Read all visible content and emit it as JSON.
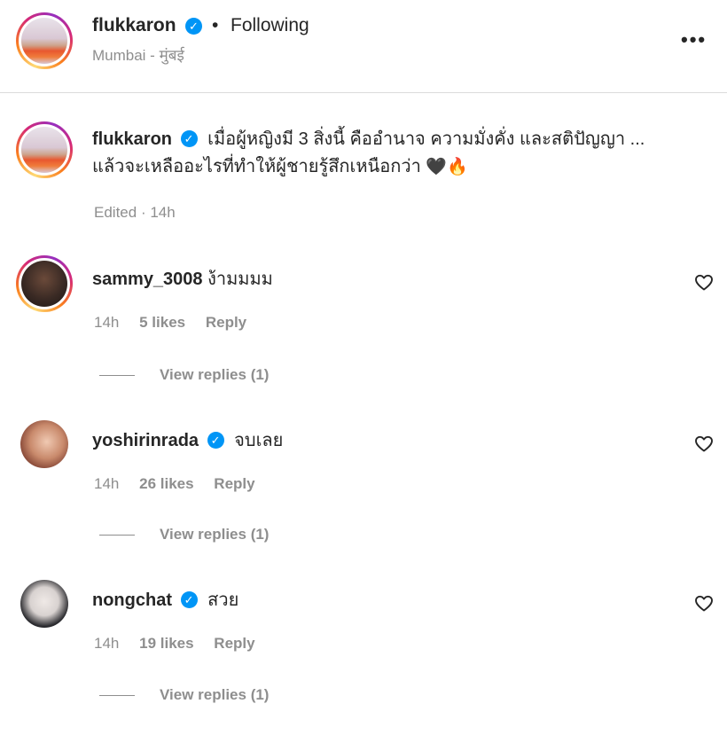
{
  "post": {
    "author": "flukkaron",
    "following_label": "Following",
    "separator": "•",
    "location": "Mumbai - मुंबई",
    "more_label": "•••"
  },
  "caption": {
    "author": "flukkaron",
    "line1": "เมื่อผู้หญิงมี 3 สิ่งนี้ คืออำนาจ ความมั่งคั่ง และสติปัญญา ...",
    "line2": "แล้วจะเหลืออะไรที่ทำให้ผู้ชายรู้สึกเหนือกว่า",
    "emoji1": "🖤",
    "emoji2": "🔥",
    "edited": "Edited",
    "dot": "·",
    "time": "14h"
  },
  "comments": [
    {
      "username": "sammy_3008",
      "text": "ง้ามมมม",
      "time": "14h",
      "likes": "5 likes",
      "reply": "Reply",
      "view_replies": "View replies (1)"
    },
    {
      "username": "yoshirinrada",
      "text": "จบเลย",
      "time": "14h",
      "likes": "26 likes",
      "reply": "Reply",
      "view_replies": "View replies (1)"
    },
    {
      "username": "nongchat",
      "text": "สวย",
      "time": "14h",
      "likes": "19 likes",
      "reply": "Reply",
      "view_replies": "View replies (1)"
    }
  ],
  "icons": {
    "verified": "verified-badge-icon",
    "like": "heart-outline-icon",
    "more": "more-options-icon"
  },
  "colors": {
    "verified": "#0095f6",
    "secondary_text": "#8e8e8e",
    "primary_text": "#262626"
  },
  "verified_glyph": "✓"
}
